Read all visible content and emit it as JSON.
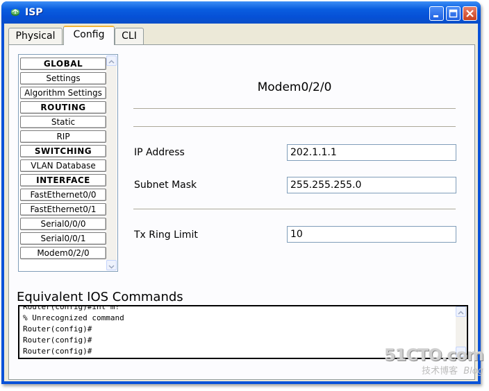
{
  "window": {
    "title": "ISP"
  },
  "tabs": [
    {
      "label": "Physical"
    },
    {
      "label": "Config"
    },
    {
      "label": "CLI"
    }
  ],
  "active_tab": "Config",
  "nav": {
    "items": [
      {
        "label": "GLOBAL",
        "header": true
      },
      {
        "label": "Settings"
      },
      {
        "label": "Algorithm Settings"
      },
      {
        "label": "ROUTING",
        "header": true
      },
      {
        "label": "Static"
      },
      {
        "label": "RIP"
      },
      {
        "label": "SWITCHING",
        "header": true
      },
      {
        "label": "VLAN Database"
      },
      {
        "label": "INTERFACE",
        "header": true
      },
      {
        "label": "FastEthernet0/0"
      },
      {
        "label": "FastEthernet0/1"
      },
      {
        "label": "Serial0/0/0"
      },
      {
        "label": "Serial0/0/1"
      },
      {
        "label": "Modem0/2/0"
      }
    ]
  },
  "interface": {
    "title": "Modem0/2/0",
    "ip_label": "IP Address",
    "ip_value": "202.1.1.1",
    "mask_label": "Subnet Mask",
    "mask_value": "255.255.255.0",
    "tx_label": "Tx Ring Limit",
    "tx_value": "10"
  },
  "console": {
    "title": "Equivalent IOS Commands",
    "lines": [
      "Router(config)#int m!",
      "% Unrecognized command",
      "Router(config)#",
      "Router(config)#",
      "Router(config)#"
    ]
  },
  "watermark": {
    "main": "51CTO.com",
    "sub": "技术博客",
    "blog": "Blog"
  }
}
